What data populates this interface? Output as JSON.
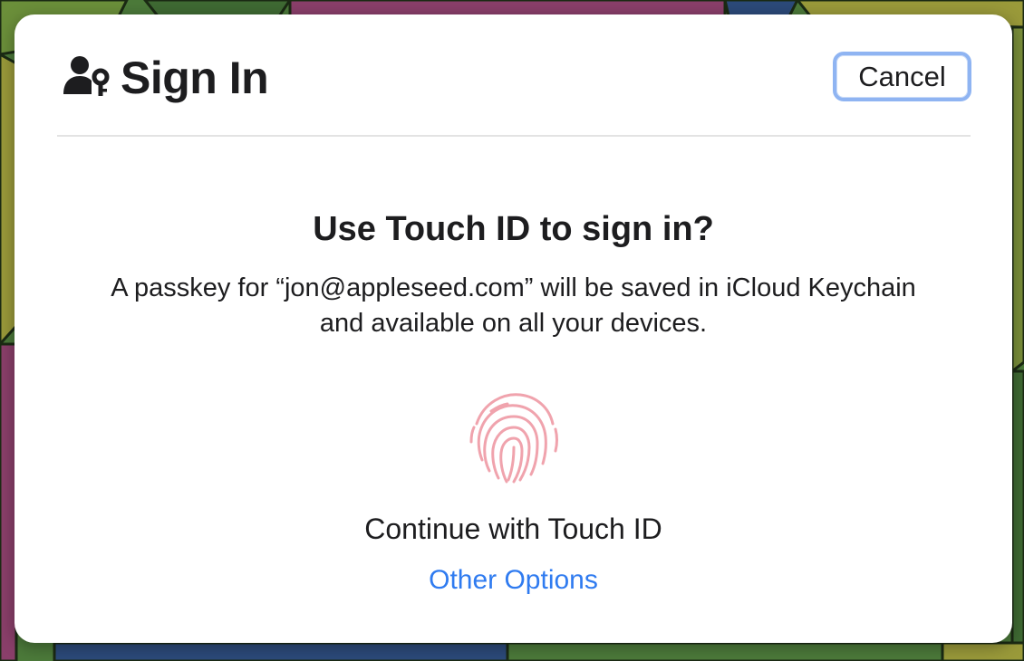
{
  "dialog": {
    "title": "Sign In",
    "title_icon": "person-key-icon",
    "cancel_label": "Cancel",
    "heading": "Use Touch ID to sign in?",
    "message": "A passkey for “jon@appleseed.com” will be saved in iCloud Keychain and available on all your devices.",
    "fingerprint_icon": "touch-id-fingerprint-icon",
    "continue_label": "Continue with Touch ID",
    "other_options_label": "Other Options"
  },
  "colors": {
    "link": "#2f7bf0",
    "fingerprint": "#f0a3ad",
    "focus_ring": "#8fb4f2",
    "text": "#1d1d1f"
  }
}
